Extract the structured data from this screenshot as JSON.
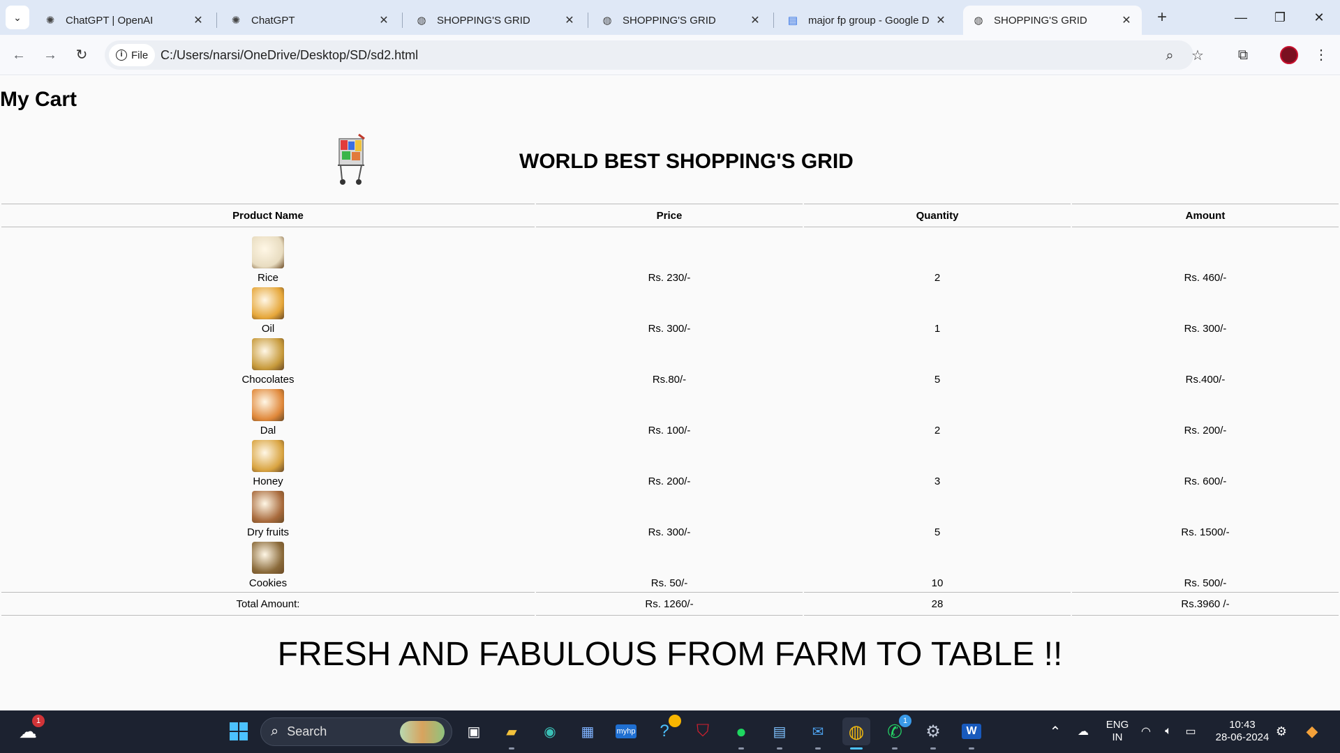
{
  "browser": {
    "tabs": [
      {
        "title": "ChatGPT | OpenAI",
        "icon": "openai-icon",
        "active": false
      },
      {
        "title": "ChatGPT",
        "icon": "openai-icon",
        "active": false
      },
      {
        "title": "SHOPPING'S GRID",
        "icon": "globe-icon",
        "active": false
      },
      {
        "title": "SHOPPING'S GRID",
        "icon": "globe-icon",
        "active": false
      },
      {
        "title": "major fp group - Google D",
        "icon": "google-docs-icon",
        "active": false
      },
      {
        "title": "SHOPPING'S GRID",
        "icon": "globe-icon",
        "active": true
      }
    ],
    "file_chip": "File",
    "url": "C:/Users/narsi/OneDrive/Desktop/SD/sd2.html"
  },
  "page": {
    "heading": "My Cart",
    "store_title": "WORLD BEST SHOPPING'S GRID",
    "columns": [
      "Product Name",
      "Price",
      "Quantity",
      "Amount"
    ],
    "products": [
      {
        "name": "Rice",
        "price": "Rs. 230/-",
        "quantity": "2",
        "amount": "Rs. 460/-",
        "image": "rice-image",
        "color": "#e8dcc0"
      },
      {
        "name": "Oil",
        "price": "Rs. 300/-",
        "quantity": "1",
        "amount": "Rs. 300/-",
        "image": "oil-image",
        "color": "#e6a73a"
      },
      {
        "name": "Chocolates",
        "price": "Rs.80/-",
        "quantity": "5",
        "amount": "Rs.400/-",
        "image": "chocolates-image",
        "color": "#c79a3b"
      },
      {
        "name": "Dal",
        "price": "Rs. 100/-",
        "quantity": "2",
        "amount": "Rs. 200/-",
        "image": "dal-image",
        "color": "#e0883a"
      },
      {
        "name": "Honey",
        "price": "Rs. 200/-",
        "quantity": "3",
        "amount": "Rs. 600/-",
        "image": "honey-image",
        "color": "#d9a441"
      },
      {
        "name": "Dry fruits",
        "price": "Rs. 300/-",
        "quantity": "5",
        "amount": "Rs. 1500/-",
        "image": "dry-fruits-image",
        "color": "#a86a3c"
      },
      {
        "name": "Cookies",
        "price": "Rs. 50/-",
        "quantity": "10",
        "amount": "Rs. 500/-",
        "image": "cookies-image",
        "color": "#8a6a3a"
      }
    ],
    "total": {
      "label": "Total Amount:",
      "price": "Rs. 1260/-",
      "quantity": "28",
      "amount": "Rs.3960 /-"
    },
    "tagline": "FRESH AND FABULOUS FROM FARM TO TABLE !!"
  },
  "taskbar": {
    "search_label": "Search",
    "weather_badge": "1",
    "whatsapp_badge": "1",
    "lang_top": "ENG",
    "lang_bottom": "IN",
    "time": "10:43",
    "date": "28-06-2024"
  }
}
